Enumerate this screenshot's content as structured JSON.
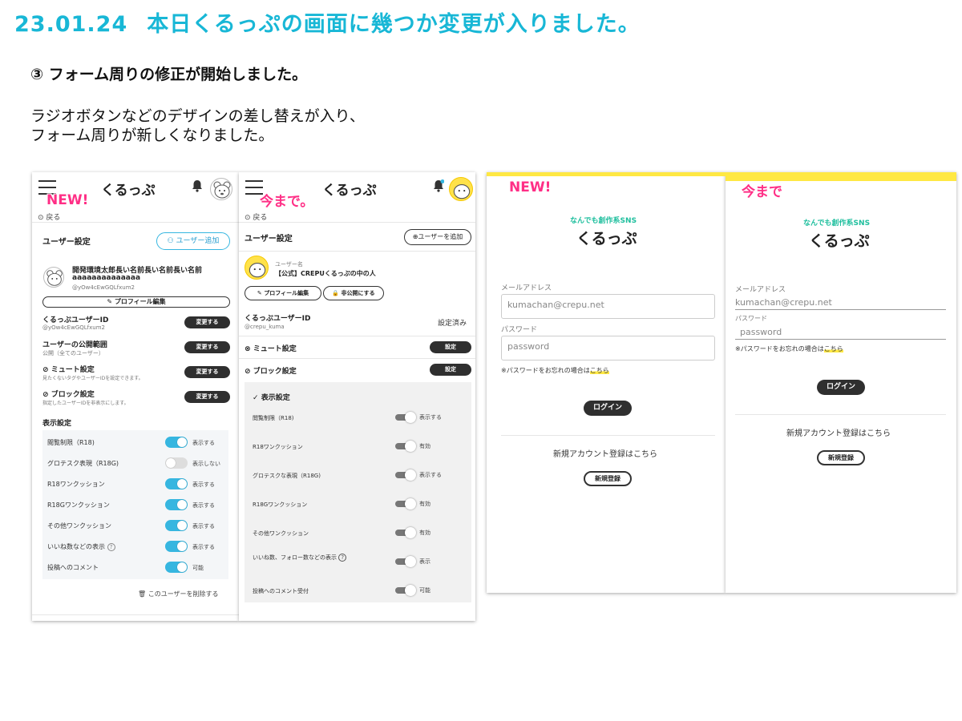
{
  "header": {
    "date": "23.01.24",
    "title": "本日くるっぷの画面に幾つか変更が入りました。",
    "subtitle": "③ フォーム周りの修正が開始しました。",
    "desc_line1": "ラジオボタンなどのデザインの差し替えが入り、",
    "desc_line2": "フォーム周りが新しくなりました。"
  },
  "colors": {
    "accent": "#18b7d6",
    "tag": "#ff2f86",
    "toggle_on": "#36b6e0",
    "brand_yellow": "#ffe843"
  },
  "tags": {
    "new": "NEW!",
    "old": "今まで。",
    "old_login": "今まで"
  },
  "app": {
    "logo": "くるっぷ",
    "back": "戻る"
  },
  "new_settings": {
    "section": "ユーザー設定",
    "add_user": "ユーザー追加",
    "user_name": "開発環境太郎長い名前長い名前長い名前",
    "user_name2": "aaaaaaaaaaaaaa",
    "user_handle": "@yOw4cEwGQLfxum2",
    "edit_profile": "プロフィール編集",
    "rows": [
      {
        "label": "くるっぷユーザーID",
        "sub": "@yOw4cEwGQLfxum2",
        "button": "変更する"
      },
      {
        "label": "ユーザーの公開範囲",
        "sub": "公開（全てのユーザー）",
        "button": "変更する"
      },
      {
        "label": "ミュート設定",
        "sub": "見たくないタグやユーザーIDを設定できます。",
        "button": "変更する"
      },
      {
        "label": "ブロック設定",
        "sub": "指定したユーザーIDを非表示にします。",
        "button": "変更する"
      }
    ],
    "display_title": "表示設定",
    "toggles": [
      {
        "label": "閲覧制限（R18)",
        "value": "表示する",
        "on": true
      },
      {
        "label": "グロテスク表現（R18G)",
        "value": "表示しない",
        "on": false
      },
      {
        "label": "R18ワンクッション",
        "value": "表示する",
        "on": true
      },
      {
        "label": "R18Gワンクッション",
        "value": "表示する",
        "on": true
      },
      {
        "label": "その他ワンクッション",
        "value": "表示する",
        "on": true
      },
      {
        "label": "いいね数などの表示",
        "value": "表示する",
        "on": true
      },
      {
        "label": "投稿へのコメント",
        "value": "可能",
        "on": true
      }
    ],
    "delete_user": "このユーザーを削除する"
  },
  "old_settings": {
    "section": "ユーザー設定",
    "add_user": "ユーザーを追加",
    "user_name_label": "ユーザー名",
    "user_name": "【公式】CREPUくるっぷの中の人",
    "edit_profile": "プロフィール編集",
    "private": "非公開にする",
    "id_label": "くるっぷユーザーID",
    "id_value": "@crepu_kuma",
    "id_status": "設定済み",
    "mute": "ミュート設定",
    "block": "ブロック設定",
    "set_button": "設定",
    "display_title": "表示設定",
    "toggles": [
      {
        "label": "閲覧制限（R18)",
        "value": "表示する"
      },
      {
        "label": "R18ワンクッション",
        "value": "有効"
      },
      {
        "label": "グロテスクな表現（R18G)",
        "value": "表示する"
      },
      {
        "label": "R18Gワンクッション",
        "value": "有効"
      },
      {
        "label": "その他ワンクッション",
        "value": "有効"
      },
      {
        "label": "いいね数、フォロー数などの表示",
        "value": "表示"
      },
      {
        "label": "投稿へのコメント受付",
        "value": "可能"
      }
    ]
  },
  "new_login": {
    "tagline": "なんでも創作系SNS",
    "title": "くるっぷ",
    "email_label": "メールアドレス",
    "email_value": "kumachan@crepu.net",
    "password_label": "パスワード",
    "password_placeholder": "password",
    "forgot_prefix": "※パスワードをお忘れの場合は",
    "forgot_link": "こちら",
    "login": "ログイン",
    "register_text": "新規アカウント登録はこちら",
    "register_button": "新規登録"
  },
  "old_login": {
    "tagline": "なんでも創作系SNS",
    "title": "くるっぷ",
    "email_label": "メールアドレス",
    "email_value": "kumachan@crepu.net",
    "password_label": "パスワード",
    "password_placeholder": "password",
    "forgot_prefix": "※パスワードをお忘れの場合は",
    "forgot_link": "こちら",
    "login": "ログイン",
    "register_text": "新規アカウント登録はこちら",
    "register_button": "新規登録"
  }
}
